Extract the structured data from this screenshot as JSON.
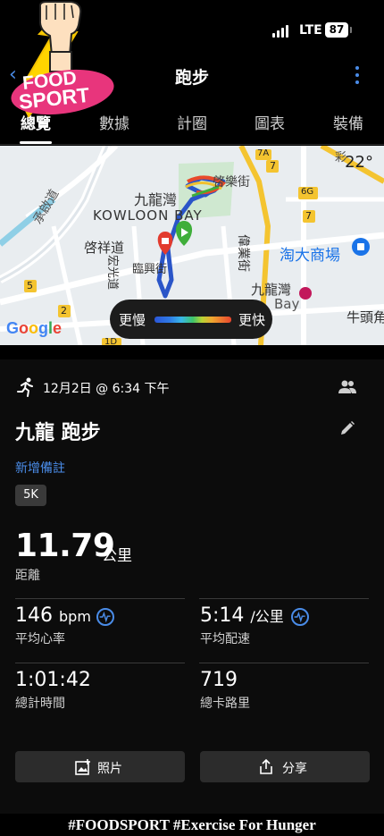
{
  "status_bar": {
    "network": "LTE",
    "battery": "87"
  },
  "overlay": {
    "logo_text": "FOOD SPORT",
    "hashtag": "#FOODSPORT #Exercise For Hunger"
  },
  "nav": {
    "title": "跑步"
  },
  "tabs": [
    {
      "label": "總覽",
      "active": true
    },
    {
      "label": "數據",
      "active": false
    },
    {
      "label": "計圈",
      "active": false
    },
    {
      "label": "圖表",
      "active": false
    },
    {
      "label": "裝備",
      "active": false
    }
  ],
  "map": {
    "temperature": "22°",
    "attribution": "Google",
    "labels": {
      "kai_lok_street": "啓樂街",
      "kowloon_bay_zh": "九龍灣",
      "kowloon_bay_en": "KOWLOON BAY",
      "sheung_yee_road": "承啟道",
      "kai_cheung_road": "啓祥道",
      "wang_kwong_road": "宏光道",
      "lam_hing_street": "臨興街",
      "wai_yip_street": "偉業街",
      "taitung": "淘大商場",
      "kowloon_bay_station": "九龍灣",
      "bay": "Bay",
      "ngau_tau_kok": "牛頭角",
      "choi_hung": "彩",
      "route_7a": "7A",
      "route_7_top": "7",
      "route_7_mid": "7",
      "route_6g": "6G",
      "route_7_right": "7",
      "route_5": "5",
      "route_2": "2",
      "route_1d": "1D"
    },
    "legend": {
      "slow": "更慢",
      "fast": "更快"
    }
  },
  "activity": {
    "datetime": "12月2日 @ 6:34 下午",
    "name": "九龍 跑步",
    "add_note": "新增備註",
    "badge": "5K",
    "distance": {
      "value": "11.79",
      "unit": "公里",
      "label": "距離"
    },
    "stats": {
      "avg_hr": {
        "value": "146",
        "unit": "bpm",
        "label": "平均心率"
      },
      "avg_pace": {
        "value": "5:14",
        "unit": "/公里",
        "label": "平均配速"
      },
      "total_time": {
        "value": "1:01:42",
        "label": "總計時間"
      },
      "calories": {
        "value": "719",
        "label": "總卡路里"
      }
    }
  },
  "actions": {
    "photos": "照片",
    "share": "分享"
  },
  "colors": {
    "accent": "#4a8ce8",
    "route_start": "#3fae3a",
    "route_end": "#e23b2e"
  }
}
